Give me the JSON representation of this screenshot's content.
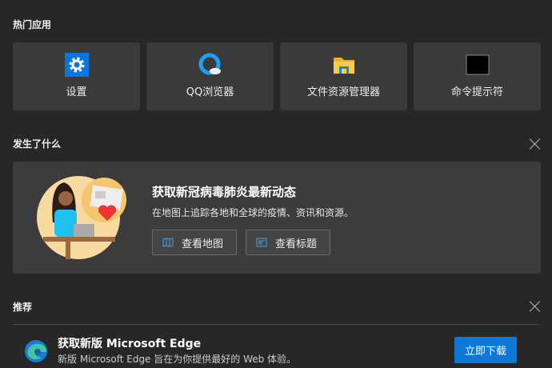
{
  "sections": {
    "popular": "热门应用",
    "whats_new": "发生了什么",
    "recommended": "推荐"
  },
  "apps": [
    {
      "label": "设置",
      "icon": "settings-icon"
    },
    {
      "label": "QQ浏览器",
      "icon": "qq-browser-icon"
    },
    {
      "label": "文件资源管理器",
      "icon": "file-explorer-icon"
    },
    {
      "label": "命令提示符",
      "icon": "command-prompt-icon"
    }
  ],
  "news": {
    "title": "获取新冠病毒肺炎最新动态",
    "desc": "在地图上追踪各地和全球的疫情、资讯和资源。",
    "map_button": "查看地图",
    "headlines_button": "查看标题"
  },
  "promo": {
    "title": "获取新版 Microsoft Edge",
    "desc": "新版 Microsoft Edge 旨在为你提供最好的 Web 体验。",
    "button": "立即下载"
  },
  "colors": {
    "accent": "#0f78d7",
    "background": "#272727"
  }
}
